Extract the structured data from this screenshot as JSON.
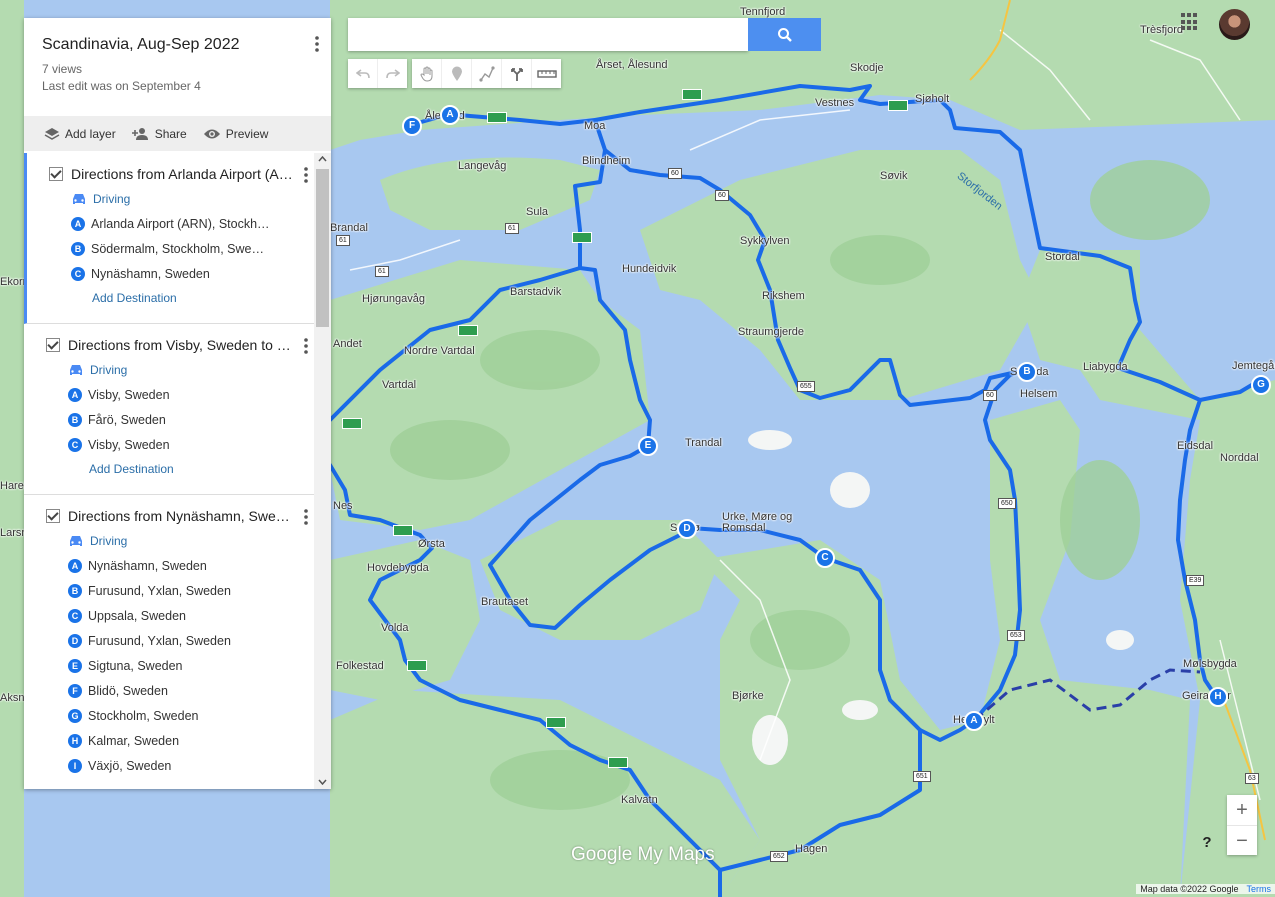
{
  "map_title": "Scandinavia, Aug-Sep 2022",
  "views": "7 views",
  "last_edit": "Last edit was on September 4",
  "actions": {
    "add_layer": "Add layer",
    "share": "Share",
    "preview": "Preview"
  },
  "search": {
    "value": ""
  },
  "toolbar": [
    "undo-icon",
    "redo-icon",
    "hand-icon",
    "marker-icon",
    "draw-line-icon",
    "directions-icon",
    "ruler-icon"
  ],
  "layers": [
    {
      "title": "Directions from Arlanda Airport (A…",
      "mode": "Driving",
      "stops": [
        {
          "letter": "A",
          "name": "Arlanda Airport (ARN), Stockh…"
        },
        {
          "letter": "B",
          "name": "Södermalm, Stockholm, Swe…"
        },
        {
          "letter": "C",
          "name": "Nynäshamn, Sweden"
        }
      ],
      "add_destination": "Add Destination"
    },
    {
      "title": "Directions from Visby, Sweden to …",
      "mode": "Driving",
      "stops": [
        {
          "letter": "A",
          "name": "Visby, Sweden"
        },
        {
          "letter": "B",
          "name": "Fårö, Sweden"
        },
        {
          "letter": "C",
          "name": "Visby, Sweden"
        }
      ],
      "add_destination": "Add Destination"
    },
    {
      "title": "Directions from Nynäshamn, Swed…",
      "mode": "Driving",
      "stops": [
        {
          "letter": "A",
          "name": "Nynäshamn, Sweden"
        },
        {
          "letter": "B",
          "name": "Furusund, Yxlan, Sweden"
        },
        {
          "letter": "C",
          "name": "Uppsala, Sweden"
        },
        {
          "letter": "D",
          "name": "Furusund, Yxlan, Sweden"
        },
        {
          "letter": "E",
          "name": "Sigtuna, Sweden"
        },
        {
          "letter": "F",
          "name": "Blidö, Sweden"
        },
        {
          "letter": "G",
          "name": "Stockholm, Sweden"
        },
        {
          "letter": "H",
          "name": "Kalmar, Sweden"
        },
        {
          "letter": "I",
          "name": "Växjö, Sweden"
        }
      ]
    }
  ],
  "map_labels": {
    "place_names": [
      "Tennfjord",
      "Trèsfjord",
      "Årset, Ålesund",
      "Skodje",
      "Vestnes",
      "Ålesund",
      "Moa",
      "Sjøholt",
      "Langevåg",
      "Blindheim",
      "Søvik",
      "Sula",
      "Brandal",
      "Sykkylven",
      "Hundeidvik",
      "Stordal",
      "Hjørungavåg",
      "Barstadvik",
      "Rikshem",
      "Straumgjerde",
      "Nordre Vartdal",
      "Andet",
      "Vartdal",
      "Liabygda",
      "Stranda",
      "Helsem",
      "Jemtegård",
      "Eidsdal",
      "Trandal",
      "Norddal",
      "Urke, Møre og Romsdal",
      "Sæbø",
      "Ørsta",
      "Hovdebygda",
      "Brautaset",
      "Volda",
      "Folkestad",
      "Mølsbygda",
      "Geiranger",
      "Bjørke",
      "Hellesylt",
      "Kalvatn",
      "Hagen",
      "Nes",
      "Hareid",
      "Larsnes",
      "Ekornes",
      "Aksnes"
    ],
    "water_names": [
      "Storfjorden"
    ],
    "road_numbers": [
      "61",
      "61",
      "61",
      "60",
      "60",
      "60",
      "63",
      "655",
      "650",
      "653",
      "651",
      "652",
      "E39"
    ]
  },
  "markers": [
    "F",
    "A",
    "E",
    "D",
    "C",
    "B",
    "A",
    "G",
    "H"
  ],
  "branding": "Google My Maps",
  "attribution": "Map data ©2022 Google",
  "terms": "Terms",
  "zoom": {
    "in": "+",
    "out": "−"
  },
  "help": "?",
  "colors": {
    "route": "#1a6ae8",
    "land": "#b4dbb0",
    "water": "#a8c8f0",
    "panel_accent": "#4a8af4"
  }
}
